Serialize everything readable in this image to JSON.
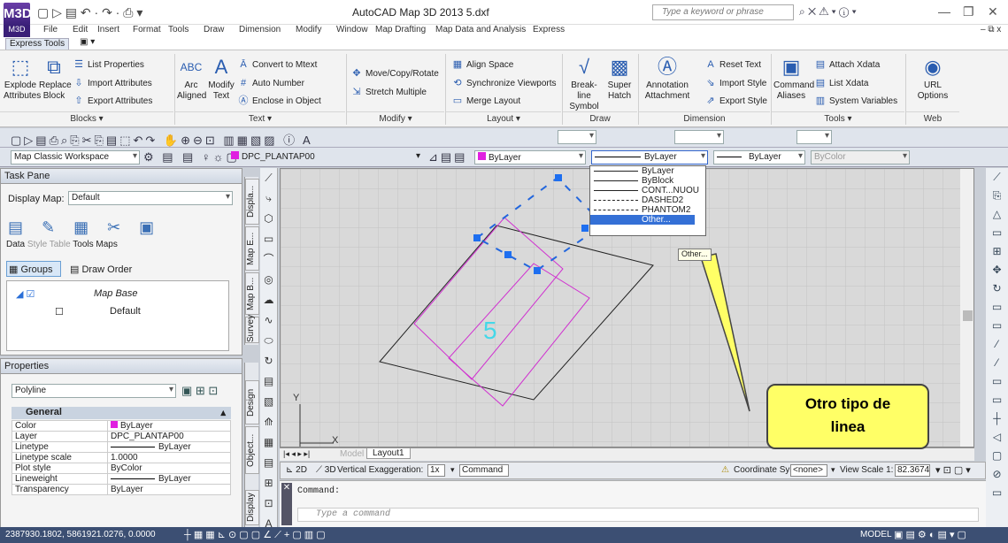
{
  "app": {
    "title": "AutoCAD Map 3D 2013   5.dxf",
    "search_placeholder": "Type a keyword or phrase",
    "logo": "M3D"
  },
  "menubar": [
    "File",
    "Edit",
    "Insert",
    "Format",
    "Tools",
    "Draw",
    "Dimension",
    "Modify",
    "Window",
    "Map Drafting",
    "Map Data and Analysis",
    "Express"
  ],
  "ribbon_tab": "Express Tools",
  "ribbon": {
    "blocks": {
      "title": "Blocks",
      "explode": "Explode\nAttributes",
      "replace": "Replace\nBlock",
      "list_props": "List Properties",
      "import_attr": "Import Attributes",
      "export_attr": "Export Attributes"
    },
    "text": {
      "title": "Text",
      "arc": "Arc\nAligned",
      "modify": "Modify\nText",
      "convert": "Convert to Mtext",
      "auto_number": "Auto Number",
      "enclose": "Enclose in Object"
    },
    "modify": {
      "title": "Modify",
      "move": "Move/Copy/Rotate",
      "stretch": "Stretch Multiple"
    },
    "layout": {
      "title": "Layout",
      "align": "Align Space",
      "sync": "Synchronize Viewports",
      "merge": "Merge Layout"
    },
    "draw": {
      "title": "Draw",
      "breakline": "Break-line\nSymbol",
      "super": "Super\nHatch"
    },
    "dimension": {
      "title": "Dimension",
      "annot": "Annotation\nAttachment",
      "reset": "Reset Text",
      "import_style": "Import Style",
      "export_style": "Export Style"
    },
    "tools": {
      "title": "Tools",
      "command": "Command\nAliases",
      "attach": "Attach Xdata",
      "list": "List Xdata",
      "sysvars": "System Variables"
    },
    "web": {
      "title": "Web",
      "url": "URL\nOptions"
    }
  },
  "toolbar2": {
    "workspace": "Map Classic Workspace",
    "layer": "DPC_PLANTAP00",
    "color": "ByLayer",
    "linetype": "ByLayer",
    "lineweight": "ByLayer",
    "plotstyle": "ByColor"
  },
  "linetype_options": [
    "ByLayer",
    "ByBlock",
    "CONT...NUOU",
    "DASHED2",
    "PHANTOM2",
    "Other..."
  ],
  "tooltip": "Other...",
  "callout": "Otro tipo de\nlinea",
  "taskpane": {
    "title": "Task Pane",
    "display_map_label": "Display Map:",
    "display_map_value": "Default",
    "tools": [
      "Data",
      "Style",
      "Table",
      "Tools",
      "Maps"
    ],
    "groups": "Groups",
    "draw_order": "Draw Order",
    "map_base": "Map Base",
    "default_layer": "Default",
    "side_tabs": [
      "Displa...",
      "Map E...",
      "Map B...",
      "Survey"
    ]
  },
  "properties": {
    "title": "Properties",
    "object": "Polyline",
    "section": "General",
    "rows": [
      {
        "k": "Color",
        "v": "ByLayer"
      },
      {
        "k": "Layer",
        "v": "DPC_PLANTAP00"
      },
      {
        "k": "Linetype",
        "v": "ByLayer"
      },
      {
        "k": "Linetype scale",
        "v": "1.0000"
      },
      {
        "k": "Plot style",
        "v": "ByColor"
      },
      {
        "k": "Lineweight",
        "v": "ByLayer"
      },
      {
        "k": "Transparency",
        "v": "ByLayer"
      }
    ],
    "side_tabs": [
      "Design",
      "Object...",
      "Display"
    ]
  },
  "canvas": {
    "label_number": "5",
    "axis_y": "Y",
    "axis_x": "X"
  },
  "layout_tabs": [
    "Model",
    "Layout1"
  ],
  "statusline": {
    "mode_2d": "2D",
    "mode_3d": "3D",
    "vert_exag_label": "Vertical Exaggeration:",
    "vert_exag": "1x",
    "command": "Command",
    "coord_label": "Coordinate System:",
    "coord_value": "<none>",
    "view_scale_label": "View Scale 1:",
    "view_scale": "82.3674"
  },
  "command": {
    "history": "Command:",
    "prompt": "Type a command"
  },
  "bottom": {
    "coords": "2387930.1802, 5861921.0276, 0.0000",
    "model": "MODEL"
  }
}
